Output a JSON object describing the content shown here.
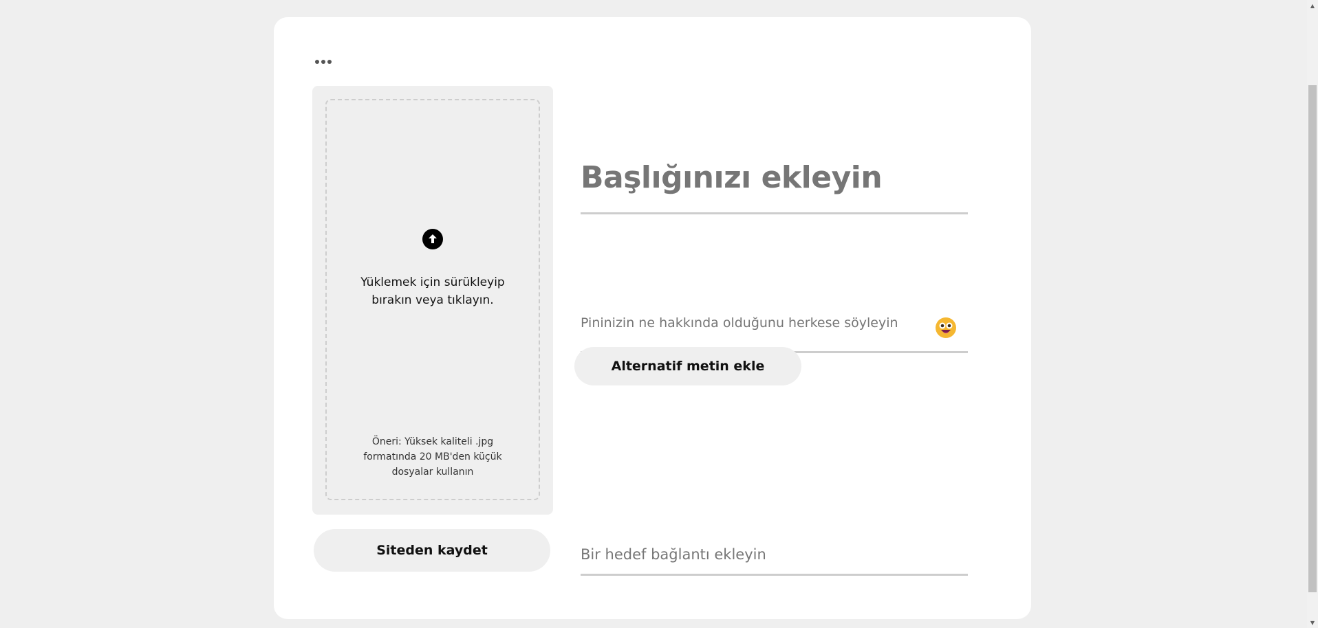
{
  "card": {
    "more_icon": "more-horizontal-icon",
    "upload": {
      "icon": "arrow-up-circle-icon",
      "instruction": "Yüklemek için sürükleyip bırakın veya tıklayın.",
      "hint": "Öneri: Yüksek kaliteli .jpg formatında 20 MB'den küçük dosyalar kullanın"
    },
    "save_from_site_label": "Siteden kaydet",
    "title_placeholder": "Başlığınızı ekleyin",
    "description_placeholder": "Pininizin ne hakkında olduğunu herkese söyleyin",
    "emoji_icon": "smiley-emoji-icon",
    "alt_text_label": "Alternatif metin ekle",
    "link_placeholder": "Bir hedef bağlantı ekleyin"
  },
  "colors": {
    "page_background": "#efefef",
    "card_background": "#ffffff",
    "field_underline": "#cdcdcd",
    "placeholder_text": "#767676",
    "emoji": "#f5b731"
  }
}
